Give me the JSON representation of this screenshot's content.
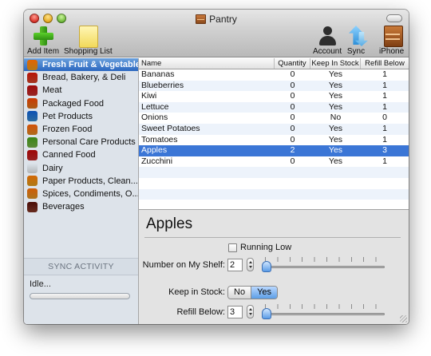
{
  "window": {
    "title": "Pantry"
  },
  "toolbar": {
    "add_item": "Add Item",
    "shopping_list": "Shopping List",
    "account": "Account",
    "sync": "Sync",
    "iphone": "iPhone"
  },
  "sidebar": {
    "categories": [
      {
        "label": "Fresh Fruit & Vegetables",
        "icon": "fruit-bowl-icon",
        "color": "#f0a020",
        "selected": true
      },
      {
        "label": "Bread, Bakery, & Deli",
        "icon": "bread-icon",
        "color": "#d9482b"
      },
      {
        "label": "Meat",
        "icon": "meat-icon",
        "color": "#c93232"
      },
      {
        "label": "Packaged Food",
        "icon": "package-icon",
        "color": "#e47a1e"
      },
      {
        "label": "Pet Products",
        "icon": "pet-bowl-icon",
        "color": "#3a8fd6"
      },
      {
        "label": "Frozen Food",
        "icon": "frozen-food-icon",
        "color": "#e8902a"
      },
      {
        "label": "Personal Care Products",
        "icon": "lotion-bottle-icon",
        "color": "#7ab84a"
      },
      {
        "label": "Canned Food",
        "icon": "can-icon",
        "color": "#c92c2c"
      },
      {
        "label": "Dairy",
        "icon": "milk-glass-icon",
        "color": "#eef2f6"
      },
      {
        "label": "Paper Products, Clean...",
        "icon": "spray-bottle-icon",
        "color": "#e8a21e"
      },
      {
        "label": "Spices, Condiments, O...",
        "icon": "spice-bottle-icon",
        "color": "#e69a2a"
      },
      {
        "label": "Beverages",
        "icon": "cocktail-glass-icon",
        "color": "#8a3b2a"
      }
    ],
    "sync_heading": "SYNC ACTIVITY",
    "sync_status": "Idle..."
  },
  "table": {
    "headers": {
      "name": "Name",
      "quantity": "Quantity",
      "keep": "Keep In Stock",
      "refill": "Refill Below"
    },
    "rows": [
      {
        "name": "Bananas",
        "quantity": "0",
        "keep": "Yes",
        "refill": "1"
      },
      {
        "name": "Blueberries",
        "quantity": "0",
        "keep": "Yes",
        "refill": "1"
      },
      {
        "name": "Kiwi",
        "quantity": "0",
        "keep": "Yes",
        "refill": "1"
      },
      {
        "name": "Lettuce",
        "quantity": "0",
        "keep": "Yes",
        "refill": "1"
      },
      {
        "name": "Onions",
        "quantity": "0",
        "keep": "No",
        "refill": "0"
      },
      {
        "name": "Sweet Potatoes",
        "quantity": "0",
        "keep": "Yes",
        "refill": "1"
      },
      {
        "name": "Tomatoes",
        "quantity": "0",
        "keep": "Yes",
        "refill": "1"
      },
      {
        "name": "Apples",
        "quantity": "2",
        "keep": "Yes",
        "refill": "3",
        "selected": true
      },
      {
        "name": "Zucchini",
        "quantity": "0",
        "keep": "Yes",
        "refill": "1"
      }
    ]
  },
  "detail": {
    "title": "Apples",
    "running_low_label": "Running Low",
    "running_low_checked": false,
    "shelf_label": "Number on My Shelf:",
    "shelf_value": "2",
    "shelf_slider_level": 0.0,
    "keep_label": "Keep in Stock:",
    "keep_options": [
      "No",
      "Yes"
    ],
    "keep_selected": "Yes",
    "refill_label": "Refill Below:",
    "refill_value": "3",
    "refill_slider_level": 0.0
  }
}
